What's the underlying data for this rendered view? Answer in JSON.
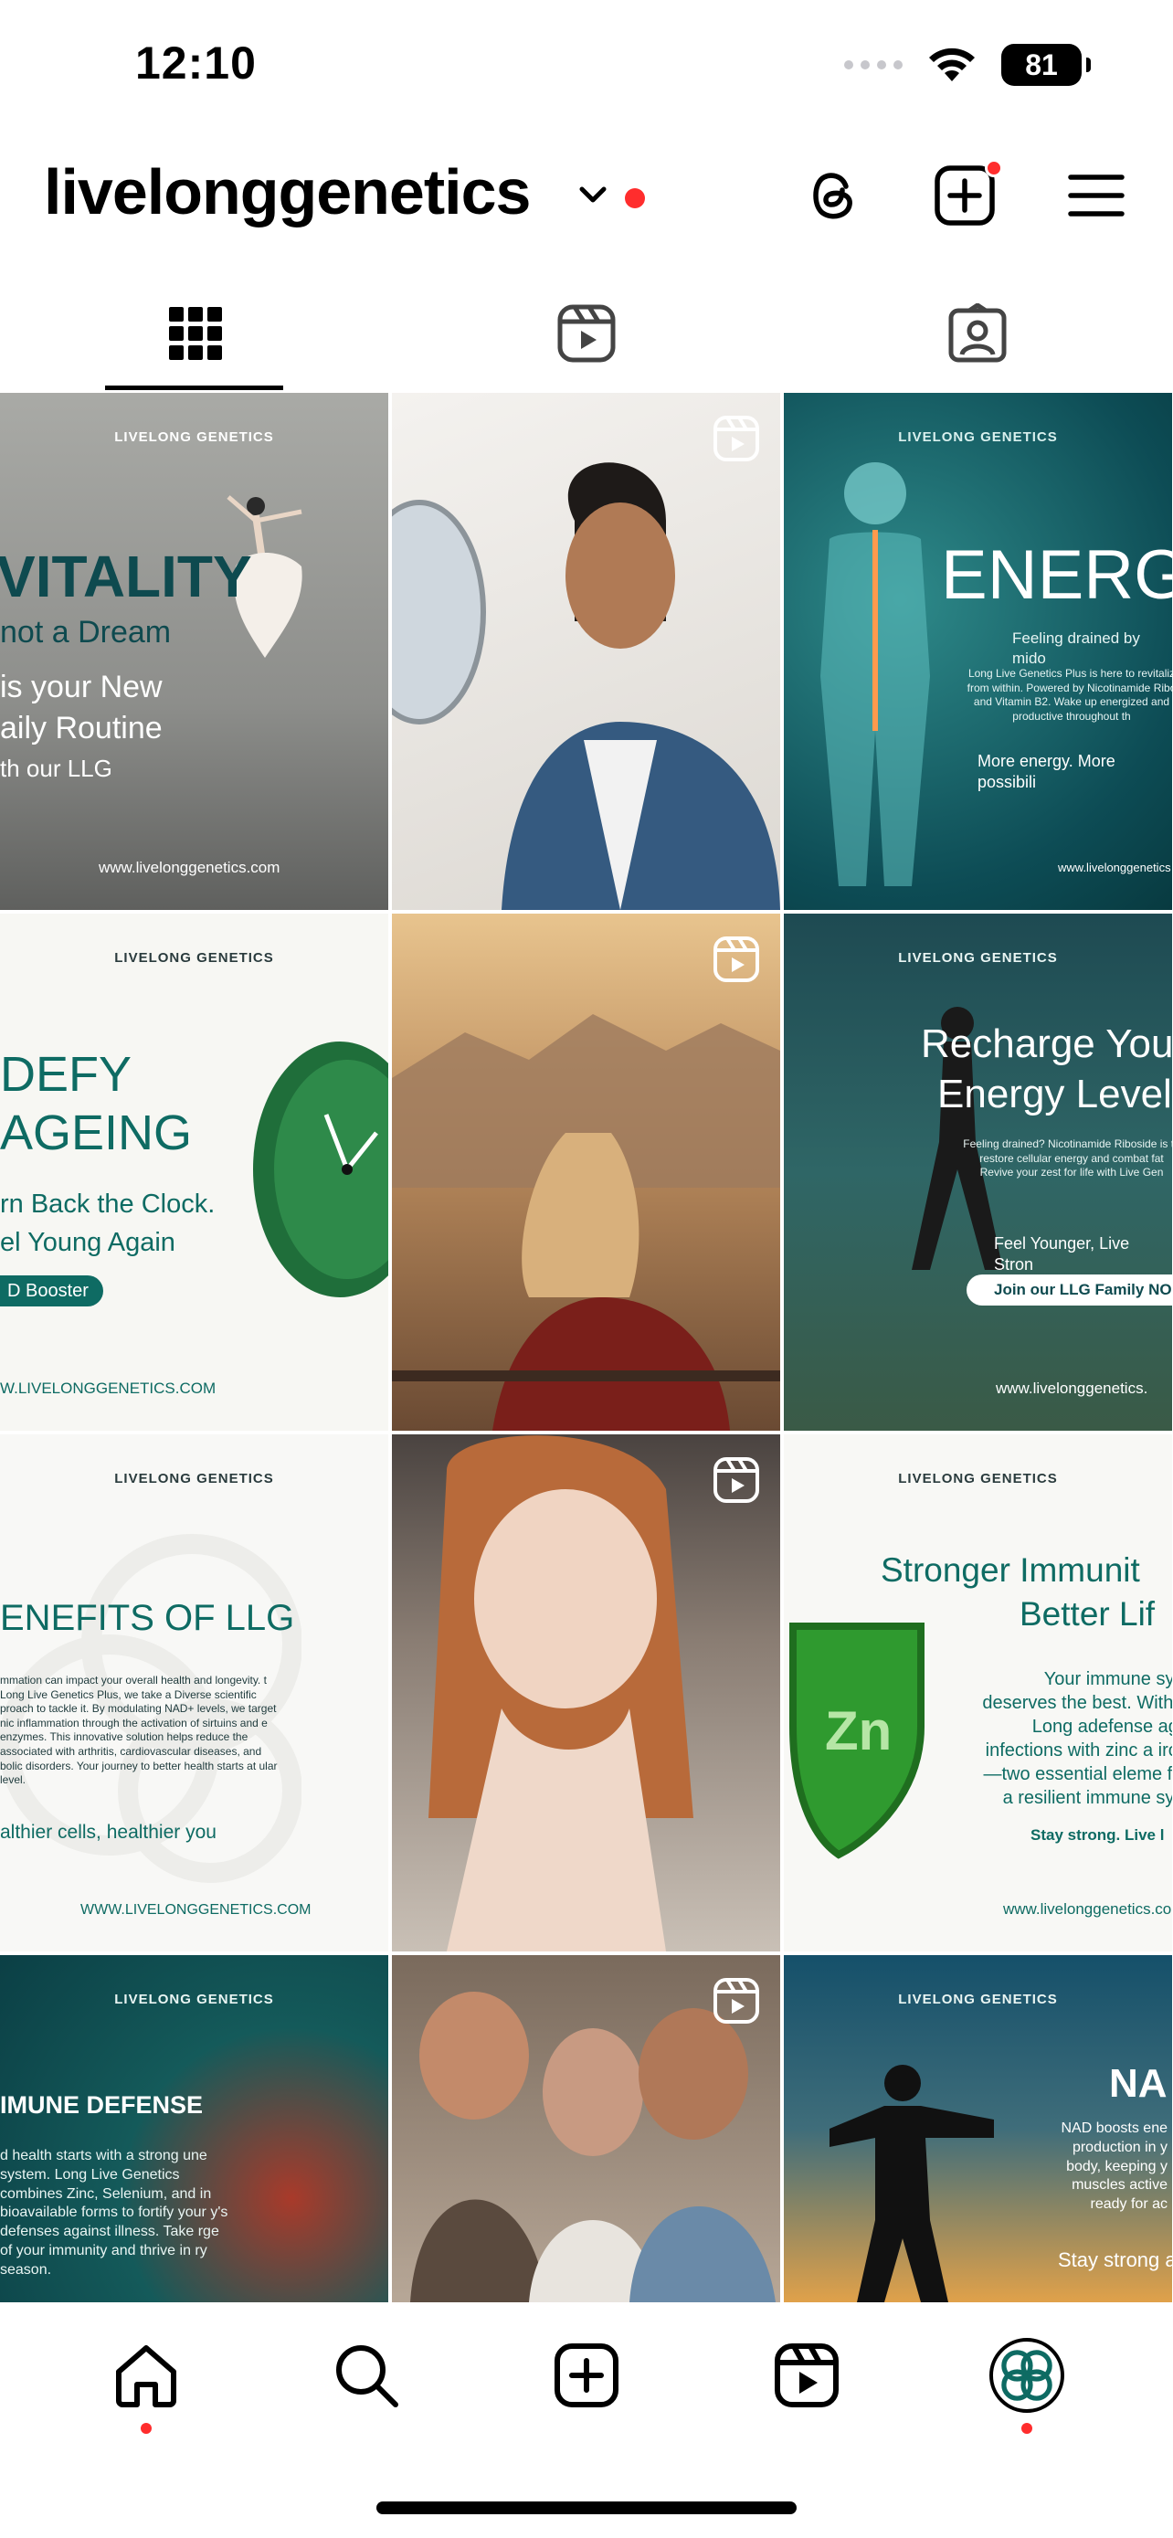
{
  "status": {
    "time": "12:10",
    "battery": "81"
  },
  "header": {
    "username": "livelonggenetics",
    "icons": [
      "chevron-down-icon",
      "threads-icon",
      "create-post-icon",
      "menu-icon"
    ]
  },
  "tabs": [
    {
      "name": "grid",
      "icon": "grid-icon",
      "active": true
    },
    {
      "name": "reels",
      "icon": "reels-icon",
      "active": false
    },
    {
      "name": "tagged",
      "icon": "tagged-icon",
      "active": false
    }
  ],
  "posts": [
    {
      "logo": "LIVELONG GENETICS",
      "title1": "VITALITY",
      "title2": "not a Dream",
      "line1": "is your New",
      "line2": "aily Routine",
      "line3": "th our LLG",
      "url": "www.livelonggenetics.com"
    },
    {
      "type": "reel"
    },
    {
      "logo": "LIVELONG GENETICS",
      "title": "ENERGY",
      "sub": "Feeling drained by mido",
      "body": "Long Live Genetics Plus is here to revitaliz from within. Powered by Nicotinamide Ribo and Vitamin B2. Wake up energized and productive throughout th",
      "tagline": "More energy. More possibili",
      "url": "www.livelonggenetics"
    },
    {
      "logo": "LIVELONG GENETICS",
      "title1": "DEFY",
      "title2": "AGEING",
      "line1": "rn Back the Clock.",
      "line2": "el Young Again",
      "pill": "D Booster",
      "url": "W.LIVELONGGENETICS.COM"
    },
    {
      "type": "reel"
    },
    {
      "logo": "LIVELONG GENETICS",
      "title1": "Recharge You",
      "title2": "Energy Level",
      "body": "Feeling drained? Nicotinamide Riboside is to restore cellular energy and combat fat Revive your zest for life with Live Gen",
      "tagline": "Feel Younger, Live Stron",
      "pill": "Join our LLG Family NO",
      "url": "www.livelonggenetics."
    },
    {
      "logo": "LIVELONG GENETICS",
      "title": "ENEFITS OF LLG",
      "body": "mmation can impact your overall health and longevity. t Long Live Genetics Plus, we take a Diverse scientific proach to tackle it. By modulating NAD+ levels, we target nic inflammation through the activation of sirtuins and e enzymes. This innovative solution helps reduce the associated with arthritis, cardiovascular diseases, and bolic disorders. Your journey to better health starts at ular level.",
      "tagline": "althier cells, healthier you",
      "url": "WWW.LIVELONGGENETICS.COM"
    },
    {
      "type": "reel"
    },
    {
      "logo": "LIVELONG GENETICS",
      "title1": "Stronger Immunit",
      "title2": "Better Lif",
      "badge": "Zn",
      "body": "Your immune syst deserves the best. With L Long adefense aga infections with zinc a iron—two essential eleme for a resilient immune syst",
      "tagline": "Stay strong. Live l",
      "url": "www.livelonggenetics.com"
    },
    {
      "logo": "LIVELONG GENETICS",
      "title": "IMUNE DEFENSE",
      "body": "d health starts with a strong une system. Long Live Genetics combines Zinc, Selenium, and in bioavailable forms to fortify your y's defenses against illness. Take rge of your immunity and thrive in ry season."
    },
    {
      "type": "reel"
    },
    {
      "logo": "LIVELONG GENETICS",
      "title": "NA",
      "body": "NAD boosts ene production in y body, keeping y muscles active ready for ac",
      "tagline": "Stay strong a"
    }
  ],
  "bottom_nav": [
    {
      "name": "home",
      "icon": "home-icon"
    },
    {
      "name": "search",
      "icon": "search-icon"
    },
    {
      "name": "create",
      "icon": "create-icon"
    },
    {
      "name": "reels",
      "icon": "reels-icon"
    },
    {
      "name": "profile",
      "icon": "avatar-icon"
    }
  ]
}
